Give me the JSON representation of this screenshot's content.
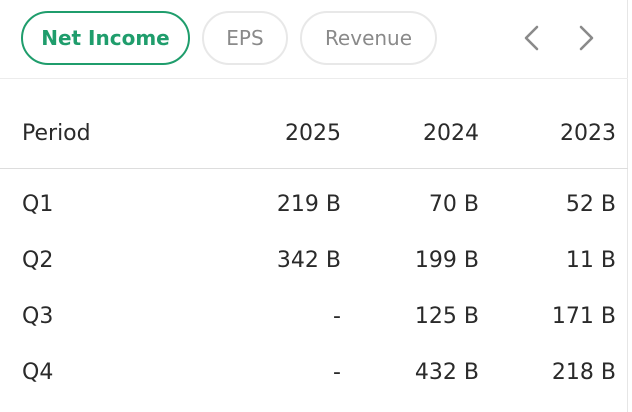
{
  "tabs": [
    {
      "label": "Net Income",
      "active": true
    },
    {
      "label": "EPS",
      "active": false
    },
    {
      "label": "Revenue",
      "active": false
    }
  ],
  "nav": {
    "prev_icon": "chevron-left-icon",
    "next_icon": "chevron-right-icon"
  },
  "table": {
    "headers": [
      "Period",
      "2025",
      "2024",
      "2023"
    ],
    "rows": [
      [
        "Q1",
        "219 B",
        "70 B",
        "52 B"
      ],
      [
        "Q2",
        "342 B",
        "199 B",
        "11 B"
      ],
      [
        "Q3",
        "-",
        "125 B",
        "171 B"
      ],
      [
        "Q4",
        "-",
        "432 B",
        "218 B"
      ]
    ]
  },
  "colors": {
    "accent": "#1f9d6c",
    "tab_border": "#e8e8e8",
    "text": "#2a2a2a",
    "muted": "#8a8a8a",
    "divider": "#dddddd"
  }
}
